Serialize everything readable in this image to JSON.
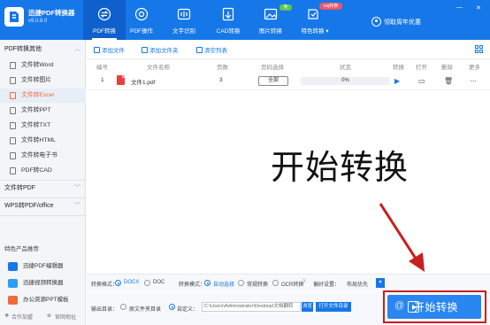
{
  "app": {
    "name": "迅捷PDF转换器",
    "version": "v9.0.8.0"
  },
  "nav": [
    {
      "label": "PDF转换",
      "icon": "swap-icon"
    },
    {
      "label": "PDF操作",
      "icon": "gear-icon"
    },
    {
      "label": "文字识别",
      "icon": "scan-text-icon"
    },
    {
      "label": "CAD转换",
      "icon": "cad-icon"
    },
    {
      "label": "图片转换",
      "icon": "image-icon"
    },
    {
      "label": "特色转换 ▾",
      "icon": "special-convert-icon"
    }
  ],
  "badges": {
    "free": "免",
    "caj": "caj转换"
  },
  "login": {
    "label": "领取周年优惠"
  },
  "colors": {
    "brand": "#1677e8",
    "accent": "#f06a3a",
    "danger": "#c8201f"
  },
  "sidebar": {
    "section1": "PDF转换其他",
    "items": [
      {
        "label": "文件转Word",
        "active": false
      },
      {
        "label": "文件转图片",
        "active": false
      },
      {
        "label": "文件转Excel",
        "active": true
      },
      {
        "label": "文件转PPT",
        "active": false
      },
      {
        "label": "文件转TXT",
        "active": false
      },
      {
        "label": "文件转HTML",
        "active": false
      },
      {
        "label": "文件转电子书",
        "active": false
      },
      {
        "label": "PDF转CAD",
        "active": false
      }
    ],
    "section2": "文件转PDF",
    "section3": "WPS转PDF/office",
    "products_title": "特色产品推荐",
    "products": [
      {
        "label": "迅捷PDF编辑器"
      },
      {
        "label": "迅捷视频转换器"
      },
      {
        "label": "办公资源PPT模板"
      }
    ],
    "bottom": {
      "join": "合作加盟",
      "website": "官网地址"
    }
  },
  "toolbar": {
    "add_file": "添加文件",
    "add_folder": "添加文件夹",
    "clear_list": "清空列表"
  },
  "table": {
    "headers": [
      "编号",
      "文件名称",
      "页数",
      "页码选择",
      "状态",
      "转换",
      "打开",
      "删除",
      "更多"
    ],
    "rows": [
      {
        "index": "1",
        "name": "文件1.pdf",
        "pages": "3",
        "page_select": "全部",
        "progress_text": "0%",
        "progress": 0
      }
    ]
  },
  "overlay_text": "开始转换",
  "settings": {
    "convert_mode_label": "转换格式：",
    "formats": [
      {
        "label": "DOCX",
        "on": true
      },
      {
        "label": "DOC",
        "on": false
      }
    ],
    "mode_label": "转换模式：",
    "modes": [
      {
        "label": "自动选择",
        "on": true
      },
      {
        "label": "常规转换",
        "on": false
      },
      {
        "label": "OCR转换",
        "on": false
      }
    ],
    "preference_label": "偏好设置：",
    "preference_value": "布局优先"
  },
  "output": {
    "label": "输出目录：",
    "option_source": "原文件夹目录",
    "option_custom": "自定义：",
    "path": "C:\\Users\\Administrator\\Desktop\\文档翻转",
    "browse": "浏览",
    "open_folder": "打开文件目录"
  },
  "start_button": {
    "label": "开始转换"
  }
}
